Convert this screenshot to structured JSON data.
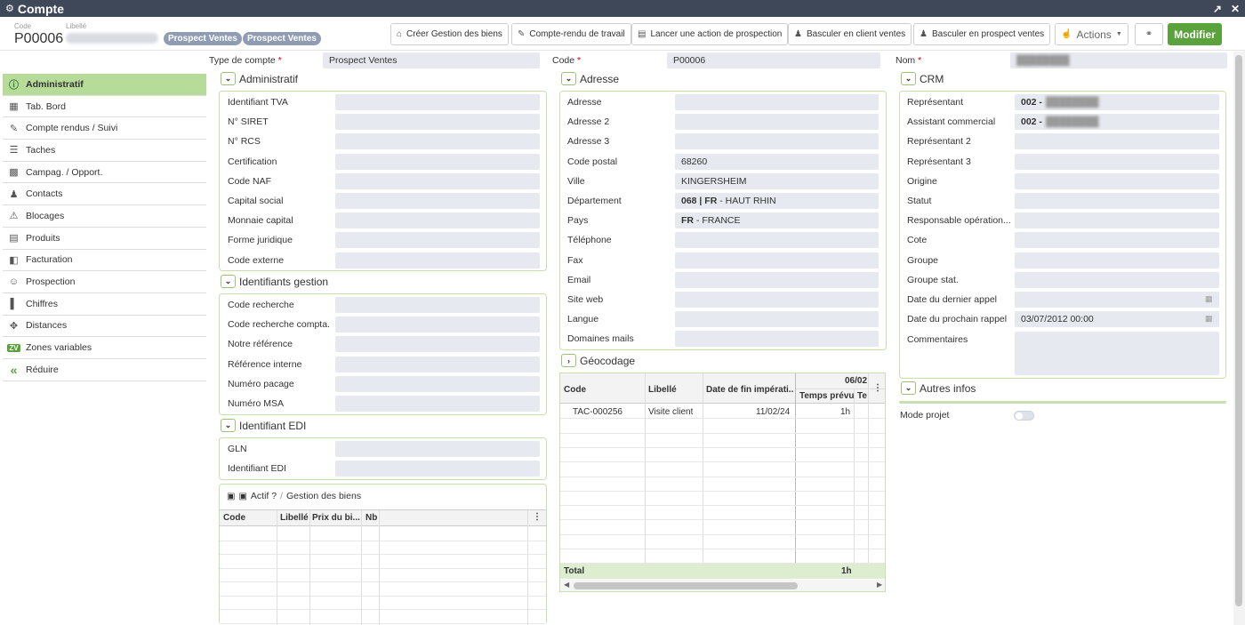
{
  "window": {
    "title": "Compte"
  },
  "header": {
    "code_label": "Code",
    "code_value": "P00006",
    "libelle_label": "Libellé",
    "badges": [
      "Prospect Ventes",
      "Prospect Ventes"
    ]
  },
  "toolbar": {
    "creer_gestion": "Créer Gestion des biens",
    "compte_rendu": "Compte-rendu de travail",
    "lancer_action": "Lancer une action de prospection",
    "basculer_client": "Basculer en client ventes",
    "basculer_prospect": "Basculer en prospect ventes",
    "actions": "Actions",
    "modifier": "Modifier"
  },
  "sidebar": {
    "items": [
      {
        "label": "Administratif",
        "icon": "info-icon"
      },
      {
        "label": "Tab. Bord",
        "icon": "dashboard-icon"
      },
      {
        "label": "Compte rendus / Suivi",
        "icon": "report-icon"
      },
      {
        "label": "Taches",
        "icon": "task-icon"
      },
      {
        "label": "Campag. / Opport.",
        "icon": "campaign-icon"
      },
      {
        "label": "Contacts",
        "icon": "contacts-icon"
      },
      {
        "label": "Blocages",
        "icon": "warning-icon"
      },
      {
        "label": "Produits",
        "icon": "product-icon"
      },
      {
        "label": "Facturation",
        "icon": "invoice-icon"
      },
      {
        "label": "Prospection",
        "icon": "prospect-icon"
      },
      {
        "label": "Chiffres",
        "icon": "chart-icon"
      },
      {
        "label": "Distances",
        "icon": "distance-icon"
      },
      {
        "label": "Zones variables",
        "icon": "zv-icon"
      },
      {
        "label": "Réduire",
        "icon": "collapse-icon"
      }
    ]
  },
  "top_fields": {
    "type_compte_label": "Type de compte",
    "type_compte_value": "Prospect Ventes",
    "code_label": "Code",
    "code_value": "P00006",
    "nom_label": "Nom"
  },
  "administratif": {
    "title": "Administratif",
    "fields": [
      "Identifiant TVA",
      "N° SIRET",
      "N° RCS",
      "Certification",
      "Code NAF",
      "Capital social",
      "Monnaie capital",
      "Forme juridique",
      "Code externe"
    ]
  },
  "identifiants_gestion": {
    "title": "Identifiants gestion",
    "fields": [
      "Code recherche",
      "Code recherche compta.",
      "Notre référence",
      "Référence interne",
      "Numéro pacage",
      "Numéro MSA"
    ]
  },
  "identifiant_edi": {
    "title": "Identifiant EDI",
    "fields": [
      "GLN",
      "Identifiant EDI"
    ]
  },
  "biens": {
    "breadcrumb_actif": "Actif ?",
    "breadcrumb_sep": "/",
    "breadcrumb_gestion": "Gestion des biens",
    "columns": [
      "Code",
      "Libellé",
      "Prix du bi...",
      "Nb"
    ]
  },
  "adresse": {
    "title": "Adresse",
    "fields": [
      {
        "label": "Adresse",
        "value": ""
      },
      {
        "label": "Adresse 2",
        "value": ""
      },
      {
        "label": "Adresse 3",
        "value": ""
      },
      {
        "label": "Code postal",
        "value": "68260"
      },
      {
        "label": "Ville",
        "value": "KINGERSHEIM"
      },
      {
        "label": "Département",
        "value_bold": "068 | FR",
        "value": " - HAUT RHIN"
      },
      {
        "label": "Pays",
        "value_bold": "FR",
        "value": " - FRANCE"
      },
      {
        "label": "Téléphone",
        "value": ""
      },
      {
        "label": "Fax",
        "value": ""
      },
      {
        "label": "Email",
        "value": ""
      },
      {
        "label": "Site web",
        "value": ""
      },
      {
        "label": "Langue",
        "value": ""
      },
      {
        "label": "Domaines mails",
        "value": ""
      }
    ]
  },
  "geocodage": {
    "title": "Géocodage",
    "columns": [
      "Code",
      "Libellé",
      "Date de fin impérati...",
      "06/02",
      "Temps prévu",
      "Te"
    ],
    "rows": [
      {
        "code": "TAC-000256",
        "libelle": "Visite client",
        "date": "11/02/24",
        "temps": "1h"
      }
    ],
    "total_label": "Total",
    "total_value": "1h"
  },
  "crm": {
    "title": "CRM",
    "fields": [
      {
        "label": "Représentant",
        "value": "002 -"
      },
      {
        "label": "Assistant commercial",
        "value": "002 -"
      },
      {
        "label": "Représentant 2",
        "value": ""
      },
      {
        "label": "Représentant 3",
        "value": ""
      },
      {
        "label": "Origine",
        "value": ""
      },
      {
        "label": "Statut",
        "value": ""
      },
      {
        "label": "Responsable opération...",
        "value": ""
      },
      {
        "label": "Cote",
        "value": ""
      },
      {
        "label": "Groupe",
        "value": ""
      },
      {
        "label": "Groupe stat.",
        "value": ""
      },
      {
        "label": "Date du dernier appel",
        "value": ""
      },
      {
        "label": "Date du prochain rappel",
        "value": "03/07/2012 00:00"
      },
      {
        "label": "Commentaires",
        "value": ""
      }
    ]
  },
  "autres_infos": {
    "title": "Autres infos",
    "mode_projet_label": "Mode projet"
  }
}
